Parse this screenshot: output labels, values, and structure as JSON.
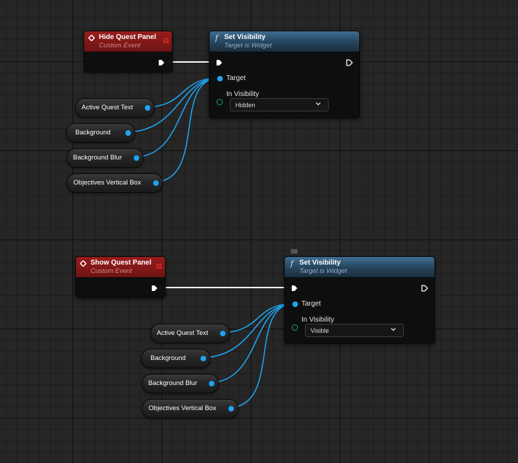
{
  "graph": {
    "groups": [
      {
        "event": {
          "title": "Hide Quest Panel",
          "subtitle": "Custom Event"
        },
        "func": {
          "title": "Set Visibility",
          "subtitle": "Target is Widget",
          "target_label": "Target",
          "visibility_label": "In Visibility",
          "visibility_value": "Hidden"
        },
        "vars": [
          "Active Quest Text",
          "Background",
          "Background Blur",
          "Objectives Vertical Box"
        ]
      },
      {
        "event": {
          "title": "Show Quest Panel",
          "subtitle": "Custom Event"
        },
        "func": {
          "title": "Set Visibility",
          "subtitle": "Target is Widget",
          "target_label": "Target",
          "visibility_label": "In Visibility",
          "visibility_value": "Visible"
        },
        "vars": [
          "Active Quest Text",
          "Background",
          "Background Blur",
          "Objectives Vertical Box"
        ]
      }
    ]
  },
  "colors": {
    "event_header": "#8a1a1a",
    "function_header": "#345a78",
    "object_pin": "#1ea4f0",
    "enum_pin": "#16a07a",
    "exec_wire": "#ffffff"
  },
  "icons": {
    "event": "event-diamond-icon",
    "function": "function-f-icon",
    "exec": "exec-arrow-icon",
    "dropdown": "chevron-down-icon"
  }
}
